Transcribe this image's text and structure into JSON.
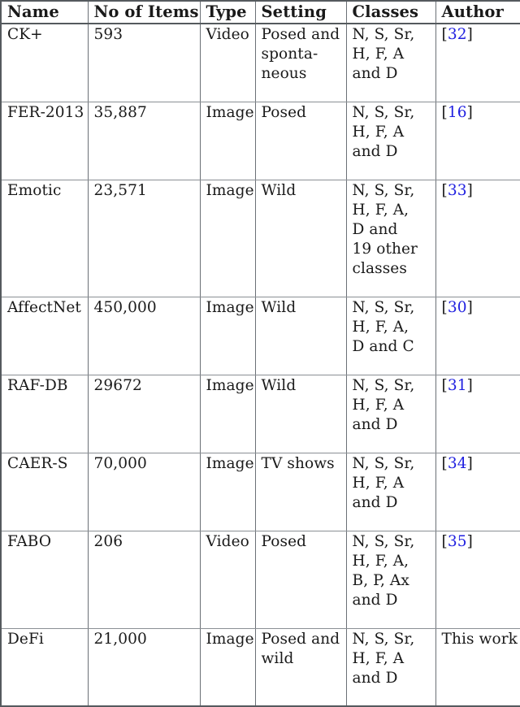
{
  "table": {
    "caption_present": false,
    "accent_citation_color": "#2020e0",
    "text_color": "#1a1a1a",
    "border_color": "#6b7076",
    "columns": [
      {
        "key": "name",
        "label": "Name"
      },
      {
        "key": "items",
        "label": "No of Items"
      },
      {
        "key": "type",
        "label": "Type"
      },
      {
        "key": "setting",
        "label": "Setting"
      },
      {
        "key": "classes",
        "label": "Classes"
      },
      {
        "key": "author",
        "label": "Author"
      }
    ],
    "rows": [
      {
        "name": "CK+",
        "items": "593",
        "type": "Video",
        "setting_lines": [
          "Posed and",
          "sponta-",
          "neous"
        ],
        "classes_lines": [
          "N, S, Sr,",
          "H, F, A",
          "and D"
        ],
        "author": "[32]",
        "author_ref": "32",
        "author_is_citation": true
      },
      {
        "name": "FER-2013",
        "items": "35,887",
        "type": "Image",
        "setting_lines": [
          "Posed"
        ],
        "classes_lines": [
          "N, S, Sr,",
          "H, F, A",
          "and D"
        ],
        "author": "[16]",
        "author_ref": "16",
        "author_is_citation": true
      },
      {
        "name": "Emotic",
        "items": "23,571",
        "type": "Image",
        "setting_lines": [
          "Wild"
        ],
        "classes_lines": [
          "N, S, Sr,",
          "H, F, A,",
          "D and",
          "19 other",
          "classes"
        ],
        "author": "[33]",
        "author_ref": "33",
        "author_is_citation": true
      },
      {
        "name": "AffectNet",
        "items": "450,000",
        "type": "Image",
        "setting_lines": [
          "Wild"
        ],
        "classes_lines": [
          "N, S, Sr,",
          "H, F, A,",
          "D and C"
        ],
        "author": "[30]",
        "author_ref": "30",
        "author_is_citation": true
      },
      {
        "name": "RAF-DB",
        "items": "29672",
        "type": "Image",
        "setting_lines": [
          "Wild"
        ],
        "classes_lines": [
          "N, S, Sr,",
          "H, F, A",
          "and D"
        ],
        "author": "[31]",
        "author_ref": "31",
        "author_is_citation": true
      },
      {
        "name": "CAER-S",
        "items": "70,000",
        "type": "Image",
        "setting_lines": [
          "TV shows"
        ],
        "classes_lines": [
          "N, S, Sr,",
          "H, F, A",
          "and D"
        ],
        "author": "[34]",
        "author_ref": "34",
        "author_is_citation": true
      },
      {
        "name": "FABO",
        "items": "206",
        "type": "Video",
        "setting_lines": [
          "Posed"
        ],
        "classes_lines": [
          "N, S, Sr,",
          "H, F, A,",
          "B, P, Ax",
          "and D"
        ],
        "author": "[35]",
        "author_ref": "35",
        "author_is_citation": true
      },
      {
        "name": "DeFi",
        "items": "21,000",
        "type": "Image",
        "setting_lines": [
          "Posed and",
          "wild"
        ],
        "classes_lines": [
          "N, S, Sr,",
          "H, F, A",
          "and D"
        ],
        "author": "This work",
        "author_ref": "",
        "author_is_citation": false
      }
    ]
  }
}
